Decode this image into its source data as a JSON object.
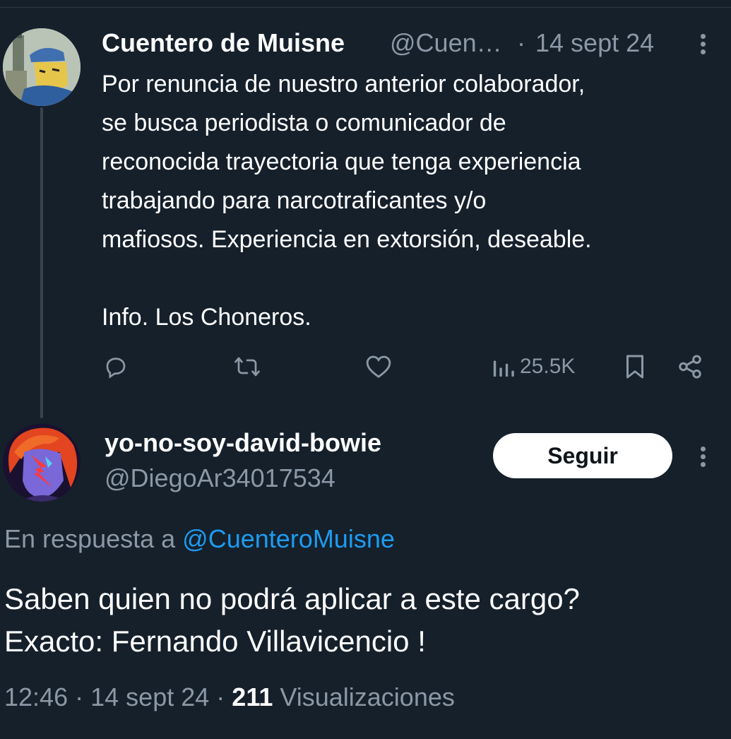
{
  "parent_tweet": {
    "author_name": "Cuentero de Muisne",
    "author_handle": "@Cuen…",
    "separator": "·",
    "date": "14 sept 24",
    "lines": [
      "Por renuncia de nuestro anterior colaborador,",
      "se busca periodista o comunicador de",
      "reconocida trayectoria que tenga experiencia",
      "trabajando para narcotraficantes y/o",
      "mafiosos. Experiencia en extorsión, deseable.",
      "Info. Los Choneros."
    ],
    "views": "25.5K"
  },
  "reply_tweet": {
    "author_name": "yo-no-soy-david-bowie",
    "author_handle": "@DiegoAr34017534",
    "follow_label": "Seguir",
    "reply_prefix": "En respuesta a",
    "reply_target": "@CuenteroMuisne",
    "lines": [
      "Saben quien no podrá aplicar a este cargo?",
      "Exacto: Fernando Villavicencio !"
    ],
    "time": "12:46",
    "sep": "·",
    "date": "14 sept 24",
    "views_count": "211",
    "views_label": "Visualizaciones"
  },
  "icons": [
    "reply-icon",
    "retweet-icon",
    "like-icon",
    "views-icon",
    "bookmark-icon",
    "share-icon",
    "more-icon"
  ],
  "colors": {
    "background": "#15202b",
    "text": "#ffffff",
    "secondary": "#8b98a5",
    "link": "#1d9bf0",
    "thread_line": "#38444d"
  }
}
